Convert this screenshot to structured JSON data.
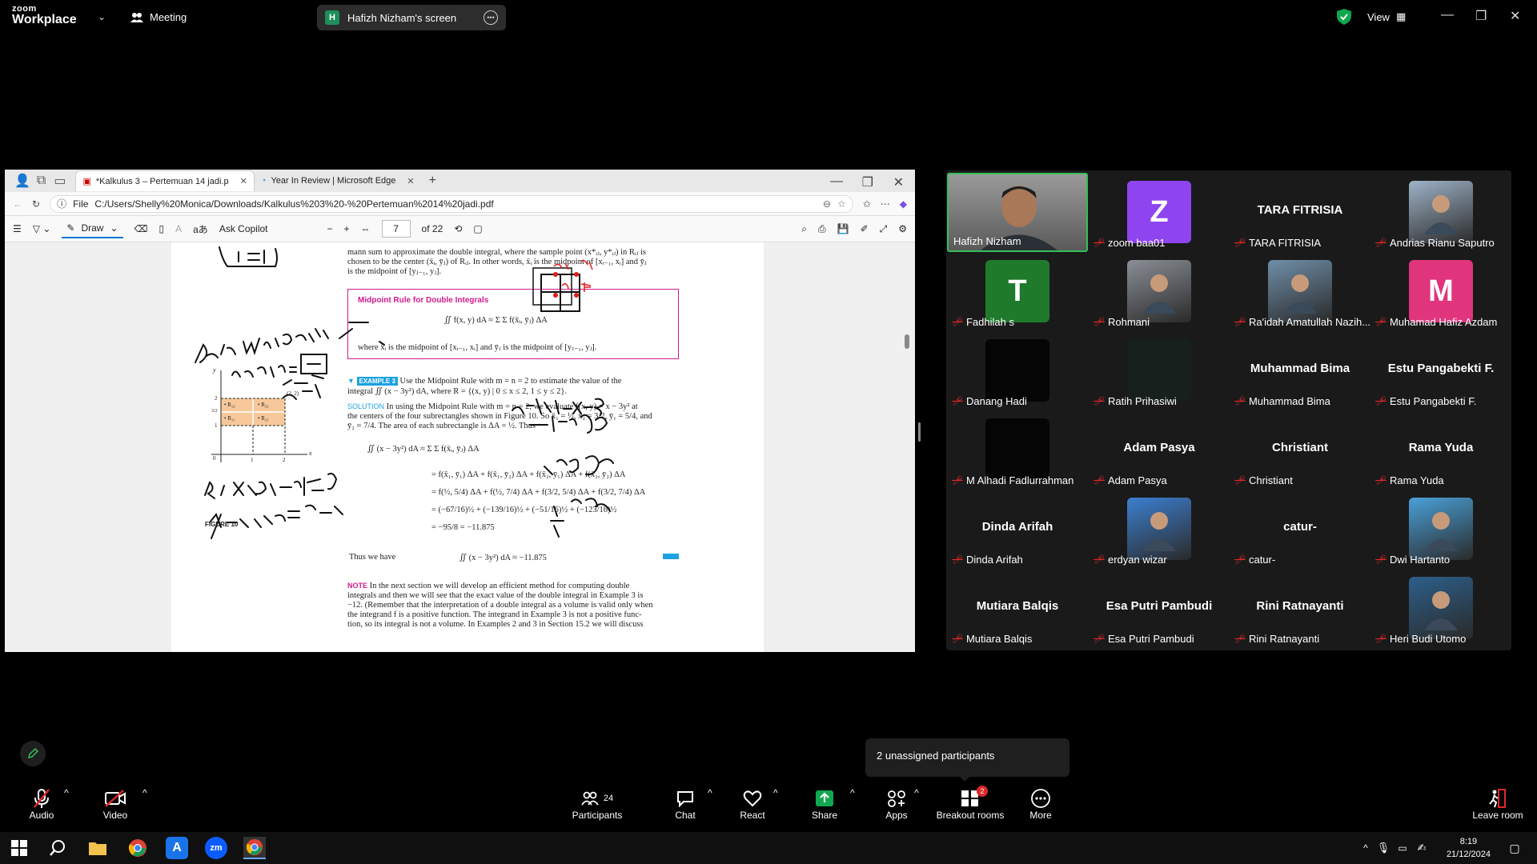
{
  "zoom": {
    "logo_top": "zoom",
    "logo_bottom": "Workplace",
    "meeting_label": "Meeting",
    "share_badge": "H",
    "share_title": "Hafizh Nizham's screen",
    "view_label": "View"
  },
  "browser": {
    "tabs": [
      {
        "label": "*Kalkulus 3 – Pertemuan 14 jadi.p"
      },
      {
        "label": "Year In Review | Microsoft Edge"
      }
    ],
    "file_label": "File",
    "url": "C:/Users/Shelly%20Monica/Downloads/Kalkulus%203%20-%20Pertemuan%2014%20jadi.pdf",
    "draw_label": "Draw",
    "ask_copilot": "Ask Copilot",
    "page_current": "7",
    "page_total": "of 22"
  },
  "pdf": {
    "p1": "mann sum to approximate the double integral, where the sample point (x*ᵢⱼ, y*ᵢⱼ) in Rᵢⱼ is",
    "p2": "chosen to be the center (x̄ᵢ, ȳⱼ) of Rᵢⱼ. In other words, x̄ᵢ is the midpoint of [xᵢ₋₁, xᵢ] and ȳⱼ",
    "p3": "is the midpoint of [yⱼ₋₁, yⱼ].",
    "rule_title": "Midpoint Rule for Double Integrals",
    "rule_formula": "∬ f(x, y) dA ≈ Σ Σ f(x̄ᵢ, ȳⱼ) ΔA",
    "rule_where": "where x̄ᵢ is the midpoint of [xᵢ₋₁, xᵢ] and ȳⱼ is the midpoint of [yⱼ₋₁, yⱼ].",
    "example_tag": "EXAMPLE 3",
    "example_text": "Use the Midpoint Rule with m = n = 2 to estimate the value of the",
    "example_text2": "integral ∬ (x − 3y²) dA, where R = {(x, y) | 0 ≤ x ≤ 2, 1 ≤ y ≤ 2}.",
    "solution_label": "SOLUTION",
    "solution_text": "In using the Midpoint Rule with m = n = 2, we evaluate f(x, y) = x − 3y² at",
    "solution_text2": "the centers of the four subrectangles shown in Figure 10. So x̄₁ = ½, x̄₂ = 3/2, ȳ₁ = 5/4, and",
    "solution_text3": "ȳ₂ = 7/4. The area of each subrectangle is ΔA = ½. Thus",
    "eq1": "∬ (x − 3y²) dA ≈ Σ Σ f(x̄ᵢ, ȳⱼ) ΔA",
    "eq2": "= f(x̄₁, ȳ₁) ΔA + f(x̄₁, ȳ₂) ΔA + f(x̄₂, ȳ₁) ΔA + f(x̄₂, ȳ₂) ΔA",
    "eq3": "= f(½, 5/4) ΔA + f(½, 7/4) ΔA + f(3/2, 5/4) ΔA + f(3/2, 7/4) ΔA",
    "eq4": "= (−67/16)½ + (−139/16)½ + (−51/16)½ + (−123/16)½",
    "eq5": "= −95/8 = −11.875",
    "thus": "Thus we have",
    "result": "∬ (x − 3y²) dA ≈ −11.875",
    "figure_label": "FIGURE 10",
    "note_label": "NOTE",
    "note1": "In the next section we will develop an efficient method for computing double",
    "note2": "integrals and then we will see that the exact value of the double integral in Example 3 is",
    "note3": "−12. (Remember that the interpretation of a double integral as a volume is valid only when",
    "note4": "the integrand f is a positive function. The integrand in Example 3 is not a positive func-",
    "note5": "tion, so its integral is not a volume. In Examples 2 and 3 in Section 15.2 we will discuss",
    "fig_r12": "• R₁₂",
    "fig_r22": "• R₂₂",
    "fig_r11": "• R₁₁",
    "fig_r21": "• R₂₁",
    "fig_pt": "(2, 2)",
    "fig_y": "y",
    "fig_x": "x",
    "fig_0": "0",
    "fig_1": "1",
    "fig_2": "2",
    "fig_y1": "1",
    "fig_y2": "2",
    "fig_y32": "3/2"
  },
  "participants": [
    {
      "name": "Hafizh Nizham",
      "type": "video",
      "muted": false
    },
    {
      "name": "zoom baa01",
      "type": "letter",
      "letter": "Z",
      "color": "#8e44ef",
      "muted": true
    },
    {
      "name": "TARA FITRISIA",
      "type": "text",
      "muted": true
    },
    {
      "name": "Andrias Rianu Saputro",
      "type": "photo",
      "color": "#9fb3c8",
      "muted": true
    },
    {
      "name": "Fadhilah s",
      "type": "letter",
      "letter": "T",
      "color": "#1f7a2c",
      "muted": true
    },
    {
      "name": "Rohmani",
      "type": "photo",
      "color": "#8a8f96",
      "muted": true
    },
    {
      "name": "Ra'idah Amatullah Nazih...",
      "type": "photo",
      "color": "#6f8fa8",
      "muted": true
    },
    {
      "name": "Muhamad Hafiz Azdam",
      "type": "letter",
      "letter": "M",
      "color": "#e0357d",
      "muted": true
    },
    {
      "name": "Danang Hadi",
      "type": "black",
      "muted": true
    },
    {
      "name": "Ratih Prihasiwi",
      "type": "dark",
      "muted": true
    },
    {
      "name": "Muhammad Bima",
      "type": "text",
      "muted": true
    },
    {
      "name": "Estu Pangabekti F.",
      "type": "text",
      "muted": true
    },
    {
      "name": "M Alhadi Fadlurrahman",
      "type": "black",
      "muted": true
    },
    {
      "name": "Adam Pasya",
      "type": "text",
      "muted": true
    },
    {
      "name": "Christiant",
      "type": "text",
      "muted": true
    },
    {
      "name": "Rama Yuda",
      "type": "text",
      "muted": true
    },
    {
      "name": "Dinda Arifah",
      "type": "text",
      "muted": true
    },
    {
      "name": "erdyan wizar",
      "type": "photo",
      "color": "#3c7fd0",
      "muted": true
    },
    {
      "name": "catur-",
      "type": "text",
      "muted": true
    },
    {
      "name": "Dwi Hartanto",
      "type": "photo",
      "color": "#4aa0d8",
      "muted": true
    },
    {
      "name": "Mutiara Balqis",
      "type": "text",
      "muted": true
    },
    {
      "name": "Esa Putri Pambudi",
      "type": "text",
      "muted": true
    },
    {
      "name": "Rini Ratnayanti",
      "type": "text",
      "muted": true
    },
    {
      "name": "Heri Budi Utomo",
      "type": "photo",
      "color": "#2d5f8a",
      "muted": true
    }
  ],
  "popup": {
    "unassigned": "2 unassigned participants"
  },
  "controls": {
    "audio": "Audio",
    "video": "Video",
    "participants": "Participants",
    "participants_count": "24",
    "chat": "Chat",
    "react": "React",
    "share": "Share",
    "apps": "Apps",
    "breakout": "Breakout rooms",
    "breakout_badge": "2",
    "more": "More",
    "leave": "Leave room"
  },
  "taskbar": {
    "time": "8:19",
    "date": "21/12/2024"
  },
  "colors": {
    "share_green": "#0fa74f",
    "speaker_border": "#35c05a",
    "mute_red": "#e02828"
  }
}
